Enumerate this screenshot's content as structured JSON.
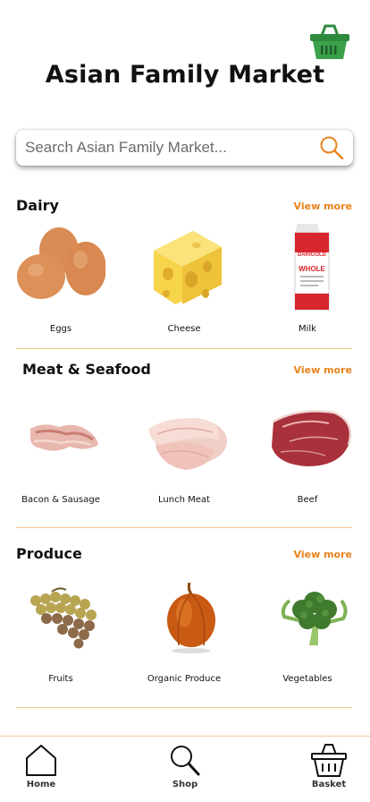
{
  "header": {
    "title": "Asian Family Market",
    "basket_icon": "basket-icon",
    "basket_color": "#3aa14a"
  },
  "search": {
    "placeholder": "Search Asian Family Market...",
    "icon": "search-icon",
    "icon_color": "#e9821b"
  },
  "accent_color": "#e9821b",
  "sections": [
    {
      "title": "Dairy",
      "view_more": "View more",
      "items": [
        {
          "label": "Eggs"
        },
        {
          "label": "Cheese"
        },
        {
          "label": "Milk",
          "carton_brand": "DARIGOLD",
          "carton_text": "WHOLE"
        }
      ]
    },
    {
      "title": "Meat & Seafood",
      "view_more": "View more",
      "items": [
        {
          "label": "Bacon & Sausage"
        },
        {
          "label": "Lunch Meat"
        },
        {
          "label": "Beef"
        }
      ]
    },
    {
      "title": "Produce",
      "view_more": "View more",
      "items": [
        {
          "label": "Fruits"
        },
        {
          "label": "Organic Produce"
        },
        {
          "label": "Vegetables"
        }
      ]
    }
  ],
  "bottom_nav": [
    {
      "label": "Home",
      "icon": "home-icon"
    },
    {
      "label": "Shop",
      "icon": "search-icon"
    },
    {
      "label": "Basket",
      "icon": "basket-icon"
    }
  ]
}
